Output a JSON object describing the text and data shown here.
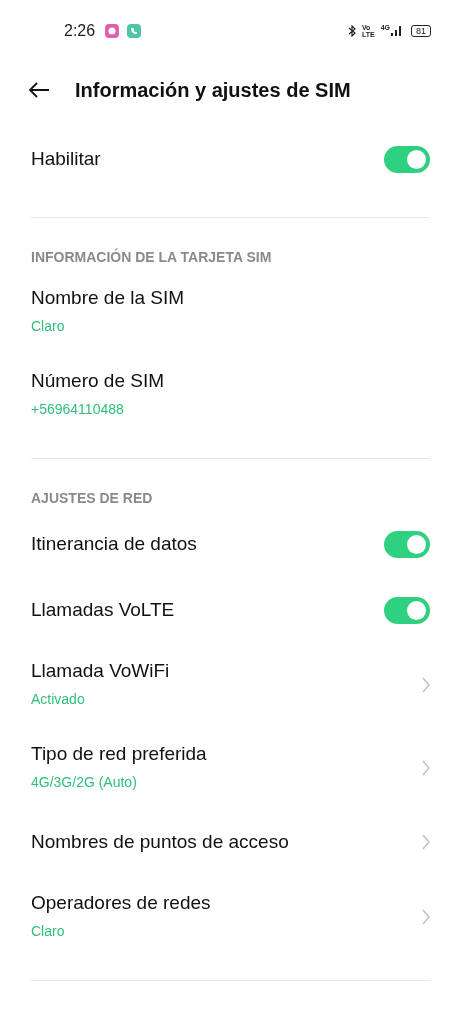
{
  "status_bar": {
    "time": "2:26",
    "volte_top": "Vo",
    "volte_bottom": "LTE",
    "network": "4G",
    "battery": "81"
  },
  "header": {
    "title": "Información y ajustes de SIM"
  },
  "sections": [
    {
      "items": [
        {
          "kind": "toggle",
          "title": "Habilitar",
          "on": true
        }
      ]
    },
    {
      "header": "INFORMACIÓN DE LA TARJETA SIM",
      "items": [
        {
          "kind": "info",
          "title": "Nombre de la SIM",
          "subtitle": "Claro"
        },
        {
          "kind": "info",
          "title": "Número de SIM",
          "subtitle": "+56964110488"
        }
      ]
    },
    {
      "header": "AJUSTES DE RED",
      "items": [
        {
          "kind": "toggle",
          "title": "Itinerancia de datos",
          "on": true
        },
        {
          "kind": "toggle",
          "title": "Llamadas VoLTE",
          "on": true
        },
        {
          "kind": "link",
          "title": "Llamada VoWiFi",
          "subtitle": "Activado"
        },
        {
          "kind": "link",
          "title": "Tipo de red preferida",
          "subtitle": "4G/3G/2G (Auto)"
        },
        {
          "kind": "link",
          "title": "Nombres de puntos de acceso"
        },
        {
          "kind": "link",
          "title": "Operadores de redes",
          "subtitle": "Claro"
        }
      ]
    }
  ]
}
